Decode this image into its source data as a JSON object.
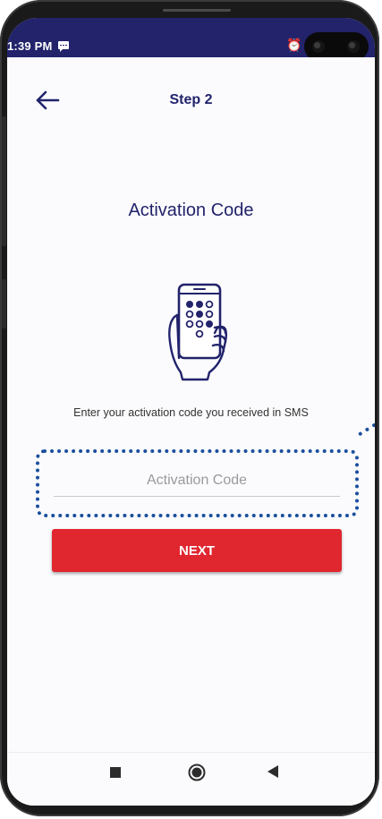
{
  "status_bar": {
    "time": "1:39 PM",
    "notification_icon": "message-icon",
    "alarm_icon": "alarm-icon",
    "battery_icon": "battery-icon"
  },
  "header": {
    "back_icon": "arrow-left-icon",
    "title": "Step 2"
  },
  "main": {
    "title": "Activation Code",
    "illustration_icon": "phone-in-hand-icon",
    "instruction": "Enter your activation code you received in SMS",
    "input": {
      "placeholder": "Activation Code",
      "value": ""
    },
    "next_label": "NEXT"
  },
  "navigation": {
    "recents_icon": "square-icon",
    "home_icon": "circle-icon",
    "back_icon": "triangle-back-icon"
  },
  "colors": {
    "brand_navy": "#22236b",
    "button_red": "#e0262f",
    "highlight_blue": "#1a4f9c"
  }
}
